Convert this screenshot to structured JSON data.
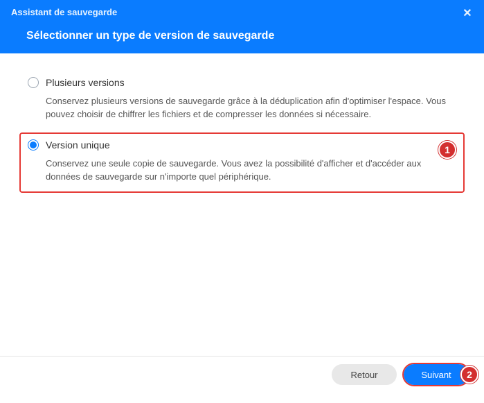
{
  "header": {
    "title": "Assistant de sauvegarde",
    "subtitle": "Sélectionner un type de version de sauvegarde"
  },
  "options": {
    "multi": {
      "title": "Plusieurs versions",
      "desc": "Conservez plusieurs versions de sauvegarde grâce à la déduplication afin d'optimiser l'espace. Vous pouvez choisir de chiffrer les fichiers et de compresser les données si nécessaire."
    },
    "single": {
      "title": "Version unique",
      "desc": "Conservez une seule copie de sauvegarde. Vous avez la possibilité d'afficher et d'accéder aux données de sauvegarde sur n'importe quel périphérique."
    }
  },
  "callouts": {
    "one": "1",
    "two": "2"
  },
  "footer": {
    "back": "Retour",
    "next": "Suivant"
  },
  "colors": {
    "accent": "#0a7cff",
    "callout": "#d32f2f",
    "highlight_border": "#e53935"
  }
}
